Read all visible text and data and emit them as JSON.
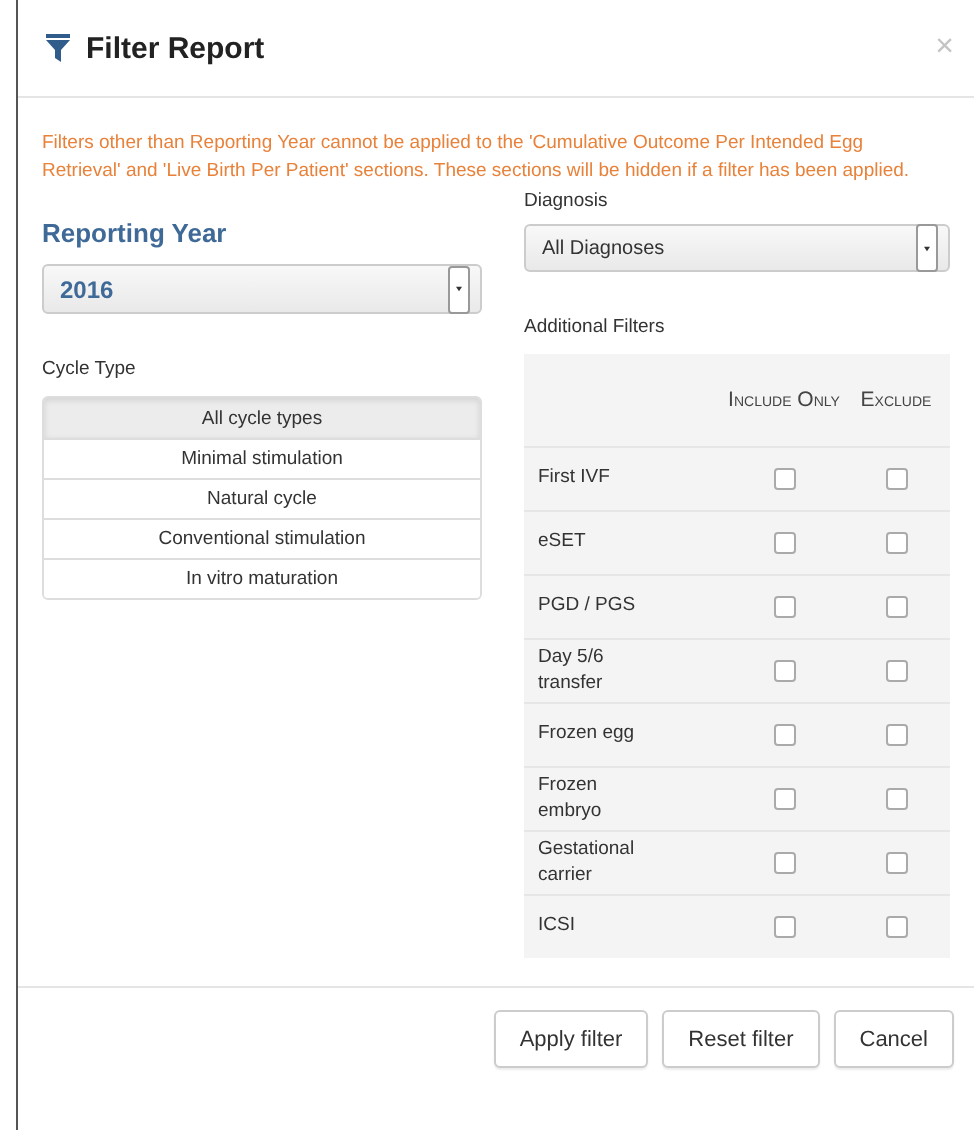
{
  "dialog": {
    "title": "Filter Report",
    "close": "×"
  },
  "notice": "Filters other than Reporting Year cannot be applied to the 'Cumulative Outcome Per Intended Egg Retrieval' and 'Live Birth Per Patient' sections. These sections will be hidden if a filter has been applied.",
  "reporting_year": {
    "label": "Reporting Year",
    "value": "2016"
  },
  "cycle_type": {
    "label": "Cycle Type",
    "options": [
      {
        "label": "All cycle types",
        "selected": true
      },
      {
        "label": "Minimal stimulation",
        "selected": false
      },
      {
        "label": "Natural cycle",
        "selected": false
      },
      {
        "label": "Conventional stimulation",
        "selected": false
      },
      {
        "label": "In vitro maturation",
        "selected": false
      }
    ]
  },
  "diagnosis": {
    "label": "Diagnosis",
    "value": "All Diagnoses"
  },
  "additional_filters": {
    "label": "Additional Filters",
    "columns": [
      "Include Only",
      "Exclude"
    ],
    "rows": [
      {
        "name": "First IVF",
        "include_only": false,
        "exclude": false
      },
      {
        "name": "eSET",
        "include_only": false,
        "exclude": false
      },
      {
        "name": "PGD / PGS",
        "include_only": false,
        "exclude": false
      },
      {
        "name": "Day 5/6 transfer",
        "include_only": false,
        "exclude": false
      },
      {
        "name": "Frozen egg",
        "include_only": false,
        "exclude": false
      },
      {
        "name": "Frozen embryo",
        "include_only": false,
        "exclude": false
      },
      {
        "name": "Gestational carrier",
        "include_only": false,
        "exclude": false
      },
      {
        "name": "ICSI",
        "include_only": false,
        "exclude": false
      }
    ]
  },
  "buttons": [
    "Apply filter",
    "Reset filter",
    "Cancel"
  ]
}
